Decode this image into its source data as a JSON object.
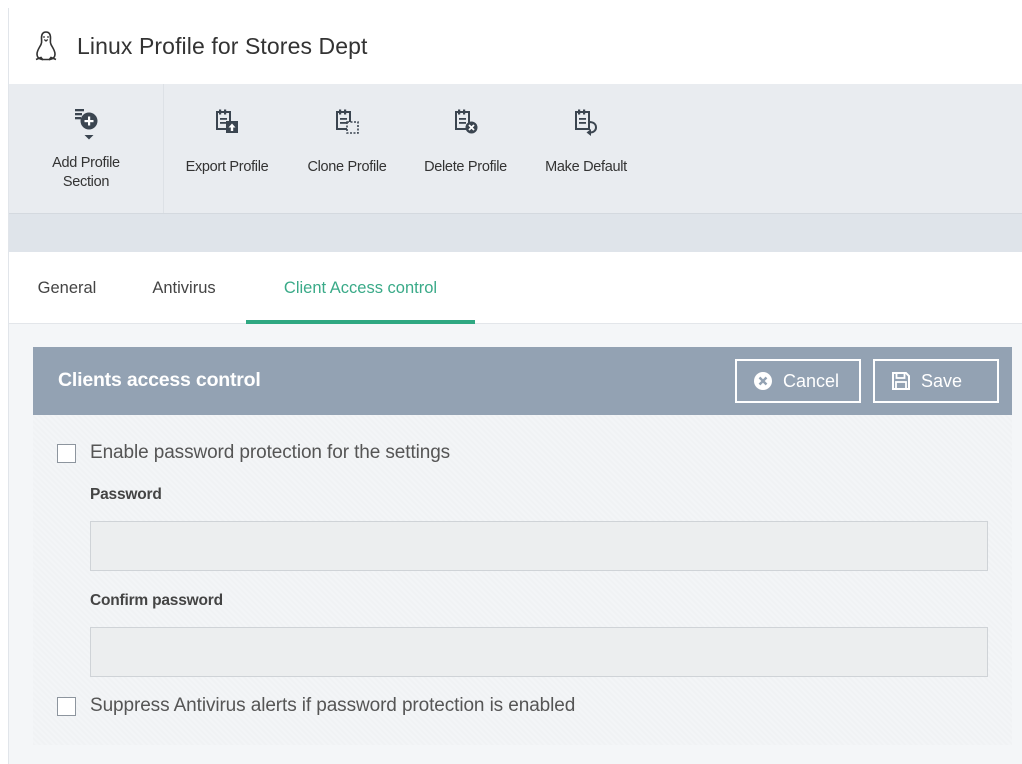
{
  "title": "Linux Profile for Stores Dept",
  "toolbar": {
    "add_label": "Add Profile\nSection",
    "export_label": "Export Profile",
    "clone_label": "Clone Profile",
    "delete_label": "Delete Profile",
    "default_label": "Make Default"
  },
  "tabs": [
    {
      "label": "General",
      "active": false
    },
    {
      "label": "Antivirus",
      "active": false
    },
    {
      "label": "Client Access control",
      "active": true
    }
  ],
  "panel": {
    "title": "Clients access control",
    "cancel_label": "Cancel",
    "save_label": "Save",
    "enable_password_label": "Enable password protection for the settings",
    "enable_password_checked": false,
    "password_label": "Password",
    "password_value": "",
    "confirm_label": "Confirm password",
    "confirm_value": "",
    "suppress_label": "Suppress Antivirus alerts if password protection is enabled",
    "suppress_checked": false
  },
  "colors": {
    "accent": "#2fa882",
    "panel_header": "#93a2b3",
    "toolbar_bg": "#e9ecf0",
    "icon_dark": "#3b4550"
  }
}
